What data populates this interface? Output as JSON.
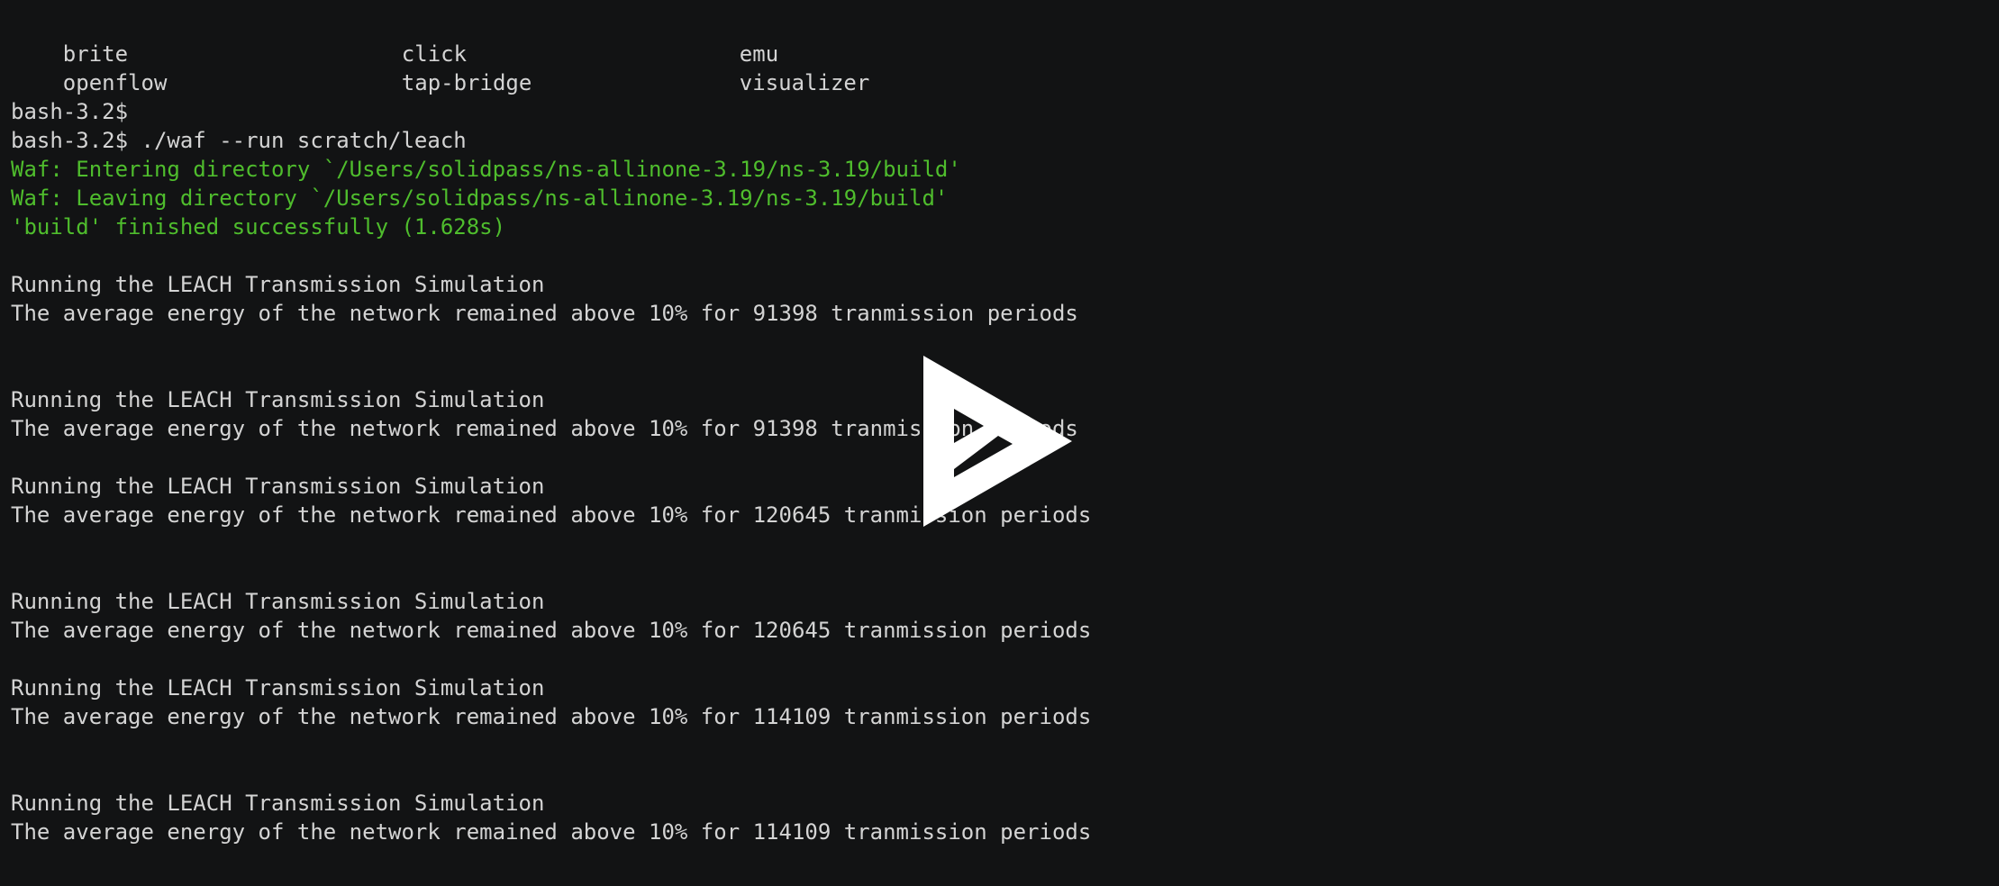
{
  "terminal": {
    "listing": [
      [
        "brite",
        "click",
        "emu"
      ],
      [
        "openflow",
        "tap-bridge",
        "visualizer"
      ]
    ],
    "lines": [
      {
        "text": "bash-3.2$",
        "color": "#d4d4d4"
      },
      {
        "text": "bash-3.2$ ./waf --run scratch/leach",
        "color": "#d4d4d4"
      },
      {
        "text": "Waf: Entering directory `/Users/solidpass/ns-allinone-3.19/ns-3.19/build'",
        "color": "#4fbd2d"
      },
      {
        "text": "Waf: Leaving directory `/Users/solidpass/ns-allinone-3.19/ns-3.19/build'",
        "color": "#4fbd2d"
      },
      {
        "text": "'build' finished successfully (1.628s)",
        "color": "#4fbd2d"
      },
      {
        "text": "Running the LEACH Transmission Simulation",
        "color": "#d4d4d4"
      },
      {
        "text": "The average energy of the network remained above 10% for 91398 tranmission periods",
        "color": "#d4d4d4"
      },
      {
        "text": "Running the LEACH Transmission Simulation",
        "color": "#d4d4d4"
      },
      {
        "text": "The average energy of the network remained above 10% for 91398 tranmission periods",
        "color": "#d4d4d4"
      },
      {
        "text": "Running the LEACH Transmission Simulation",
        "color": "#d4d4d4"
      },
      {
        "text": "The average energy of the network remained above 10% for 120645 tranmission periods",
        "color": "#d4d4d4"
      },
      {
        "text": "Running the LEACH Transmission Simulation",
        "color": "#d4d4d4"
      },
      {
        "text": "The average energy of the network remained above 10% for 120645 tranmission periods",
        "color": "#d4d4d4"
      },
      {
        "text": "Running the LEACH Transmission Simulation",
        "color": "#d4d4d4"
      },
      {
        "text": "The average energy of the network remained above 10% for 114109 tranmission periods",
        "color": "#d4d4d4"
      },
      {
        "text": "Running the LEACH Transmission Simulation",
        "color": "#d4d4d4"
      },
      {
        "text": "The average energy of the network remained above 10% for 114109 tranmission periods",
        "color": "#d4d4d4"
      }
    ]
  },
  "overlay": {
    "icon": "asciinema-play-icon",
    "color": "#ffffff"
  }
}
